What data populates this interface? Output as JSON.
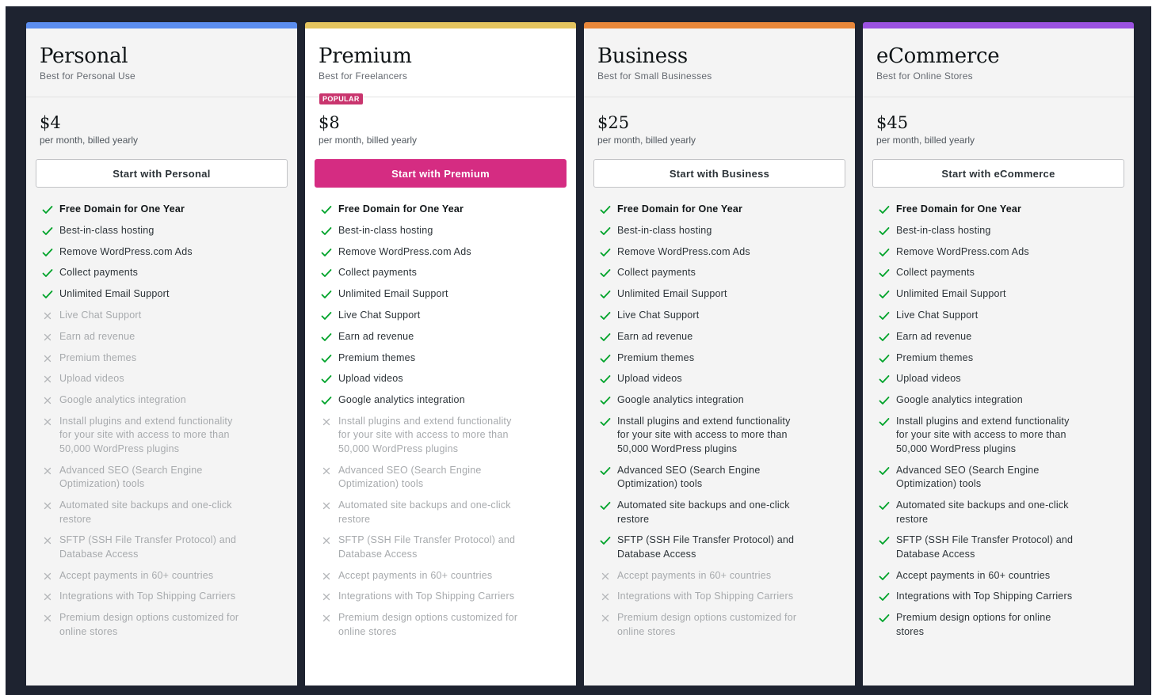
{
  "plans": [
    {
      "name": "Personal",
      "tagline": "Best for Personal Use",
      "badge": "",
      "price": "$4",
      "period": "per month, billed yearly",
      "cta": "Start with Personal",
      "accent": "#5b8def",
      "featured": false,
      "features": [
        {
          "text": "Free Domain for One Year",
          "included": true,
          "bold": true
        },
        {
          "text": "Best-in-class hosting",
          "included": true
        },
        {
          "text": "Remove WordPress.com Ads",
          "included": true
        },
        {
          "text": "Collect payments",
          "included": true
        },
        {
          "text": "Unlimited Email Support",
          "included": true
        },
        {
          "text": "Live Chat Support",
          "included": false
        },
        {
          "text": "Earn ad revenue",
          "included": false
        },
        {
          "text": "Premium themes",
          "included": false
        },
        {
          "text": "Upload videos",
          "included": false
        },
        {
          "text": "Google analytics integration",
          "included": false
        },
        {
          "text": "Install plugins and extend functionality for your site with access to more than 50,000 WordPress plugins",
          "included": false
        },
        {
          "text": "Advanced SEO (Search Engine Optimization) tools",
          "included": false
        },
        {
          "text": "Automated site backups and one-click restore",
          "included": false
        },
        {
          "text": "SFTP (SSH File Transfer Protocol) and Database Access",
          "included": false
        },
        {
          "text": "Accept payments in 60+ countries",
          "included": false
        },
        {
          "text": "Integrations with Top Shipping Carriers",
          "included": false
        },
        {
          "text": "Premium design options customized for online stores",
          "included": false
        }
      ]
    },
    {
      "name": "Premium",
      "tagline": "Best for Freelancers",
      "badge": "POPULAR",
      "price": "$8",
      "period": "per month, billed yearly",
      "cta": "Start with Premium",
      "accent": "#e4c45f",
      "featured": true,
      "features": [
        {
          "text": "Free Domain for One Year",
          "included": true,
          "bold": true
        },
        {
          "text": "Best-in-class hosting",
          "included": true
        },
        {
          "text": "Remove WordPress.com Ads",
          "included": true
        },
        {
          "text": "Collect payments",
          "included": true
        },
        {
          "text": "Unlimited Email Support",
          "included": true
        },
        {
          "text": "Live Chat Support",
          "included": true
        },
        {
          "text": "Earn ad revenue",
          "included": true
        },
        {
          "text": "Premium themes",
          "included": true
        },
        {
          "text": "Upload videos",
          "included": true
        },
        {
          "text": "Google analytics integration",
          "included": true
        },
        {
          "text": "Install plugins and extend functionality for your site with access to more than 50,000 WordPress plugins",
          "included": false
        },
        {
          "text": "Advanced SEO (Search Engine Optimization) tools",
          "included": false
        },
        {
          "text": "Automated site backups and one-click restore",
          "included": false
        },
        {
          "text": "SFTP (SSH File Transfer Protocol) and Database Access",
          "included": false
        },
        {
          "text": "Accept payments in 60+ countries",
          "included": false
        },
        {
          "text": "Integrations with Top Shipping Carriers",
          "included": false
        },
        {
          "text": "Premium design options customized for online stores",
          "included": false
        }
      ]
    },
    {
      "name": "Business",
      "tagline": "Best for Small Businesses",
      "badge": "",
      "price": "$25",
      "period": "per month, billed yearly",
      "cta": "Start with Business",
      "accent": "#e8873a",
      "featured": false,
      "features": [
        {
          "text": "Free Domain for One Year",
          "included": true,
          "bold": true
        },
        {
          "text": "Best-in-class hosting",
          "included": true
        },
        {
          "text": "Remove WordPress.com Ads",
          "included": true
        },
        {
          "text": "Collect payments",
          "included": true
        },
        {
          "text": "Unlimited Email Support",
          "included": true
        },
        {
          "text": "Live Chat Support",
          "included": true
        },
        {
          "text": "Earn ad revenue",
          "included": true
        },
        {
          "text": "Premium themes",
          "included": true
        },
        {
          "text": "Upload videos",
          "included": true
        },
        {
          "text": "Google analytics integration",
          "included": true
        },
        {
          "text": "Install plugins and extend functionality for your site with access to more than 50,000 WordPress plugins",
          "included": true
        },
        {
          "text": "Advanced SEO (Search Engine Optimization) tools",
          "included": true
        },
        {
          "text": "Automated site backups and one-click restore",
          "included": true
        },
        {
          "text": "SFTP (SSH File Transfer Protocol) and Database Access",
          "included": true
        },
        {
          "text": "Accept payments in 60+ countries",
          "included": false
        },
        {
          "text": "Integrations with Top Shipping Carriers",
          "included": false
        },
        {
          "text": "Premium design options customized for online stores",
          "included": false
        }
      ]
    },
    {
      "name": "eCommerce",
      "tagline": "Best for Online Stores",
      "badge": "",
      "price": "$45",
      "period": "per month, billed yearly",
      "cta": "Start with eCommerce",
      "accent": "#9b51e0",
      "featured": false,
      "features": [
        {
          "text": "Free Domain for One Year",
          "included": true,
          "bold": true
        },
        {
          "text": "Best-in-class hosting",
          "included": true
        },
        {
          "text": "Remove WordPress.com Ads",
          "included": true
        },
        {
          "text": "Collect payments",
          "included": true
        },
        {
          "text": "Unlimited Email Support",
          "included": true
        },
        {
          "text": "Live Chat Support",
          "included": true
        },
        {
          "text": "Earn ad revenue",
          "included": true
        },
        {
          "text": "Premium themes",
          "included": true
        },
        {
          "text": "Upload videos",
          "included": true
        },
        {
          "text": "Google analytics integration",
          "included": true
        },
        {
          "text": "Install plugins and extend functionality for your site with access to more than 50,000 WordPress plugins",
          "included": true
        },
        {
          "text": "Advanced SEO (Search Engine Optimization) tools",
          "included": true
        },
        {
          "text": "Automated site backups and one-click restore",
          "included": true
        },
        {
          "text": "SFTP (SSH File Transfer Protocol) and Database Access",
          "included": true
        },
        {
          "text": "Accept payments in 60+ countries",
          "included": true
        },
        {
          "text": "Integrations with Top Shipping Carriers",
          "included": true
        },
        {
          "text": "Premium design options for online stores",
          "included": true
        }
      ]
    }
  ],
  "colors": {
    "background": "#1e2330",
    "check": "#00a32a",
    "cross": "#a7aaad",
    "primary_button": "#d52c82",
    "badge": "#c9356e"
  },
  "icons": {
    "included": "check-icon",
    "excluded": "cross-icon"
  }
}
